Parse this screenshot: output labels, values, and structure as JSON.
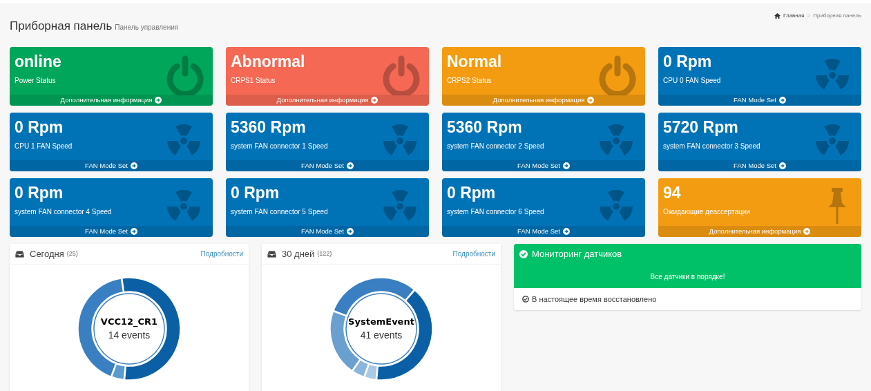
{
  "header": {
    "title": "Приборная панель",
    "subtitle": "Панель управления",
    "breadcrumb": [
      "Главная",
      "Приборная панель"
    ],
    "breadcrumb_separator": ">"
  },
  "tiles": [
    {
      "value": "online",
      "label": "Power Status",
      "link": "Дополнительная информация",
      "kind": "power",
      "color": "#00a65a"
    },
    {
      "value": "Abnormal",
      "label": "CRPS1 Status",
      "link": "Дополнительная информация",
      "kind": "power",
      "color": "#f56954"
    },
    {
      "value": "Normal",
      "label": "CRPS2 Status",
      "link": "Дополнительная информация",
      "kind": "power",
      "color": "#f39c12"
    },
    {
      "value": "0 Rpm",
      "label": "CPU 0 FAN Speed",
      "link": "FAN Mode Set",
      "kind": "fan",
      "color": "#0073b7"
    },
    {
      "value": "0 Rpm",
      "label": "CPU 1 FAN Speed",
      "link": "FAN Mode Set",
      "kind": "fan",
      "color": "#0073b7"
    },
    {
      "value": "5360 Rpm",
      "label": "system FAN connector 1 Speed",
      "link": "FAN Mode Set",
      "kind": "fan",
      "color": "#0073b7"
    },
    {
      "value": "5360 Rpm",
      "label": "system FAN connector 2 Speed",
      "link": "FAN Mode Set",
      "kind": "fan",
      "color": "#0073b7"
    },
    {
      "value": "5720 Rpm",
      "label": "system FAN connector 3 Speed",
      "link": "FAN Mode Set",
      "kind": "fan",
      "color": "#0073b7"
    },
    {
      "value": "0 Rpm",
      "label": "system FAN connector 4 Speed",
      "link": "FAN Mode Set",
      "kind": "fan",
      "color": "#0073b7"
    },
    {
      "value": "0 Rpm",
      "label": "system FAN connector 5 Speed",
      "link": "FAN Mode Set",
      "kind": "fan",
      "color": "#0073b7"
    },
    {
      "value": "0 Rpm",
      "label": "system FAN connector 6 Speed",
      "link": "FAN Mode Set",
      "kind": "fan",
      "color": "#0073b7"
    },
    {
      "value": "94",
      "label": "Ожидающие деассертации",
      "link": "Дополнительная информация",
      "kind": "pin",
      "color": "#f39c12"
    }
  ],
  "event_panels": [
    {
      "title": "Сегодня",
      "count": "(25)",
      "link": "Подробности",
      "center_title": "VCC12_CR1",
      "center_text": "14 events"
    },
    {
      "title": "30 дней",
      "count": "(122)",
      "link": "Подробности",
      "center_title": "SystemEvent",
      "center_text": "41 events"
    }
  ],
  "monitor": {
    "title": "Мониторинг датчиков",
    "message": "Все датчики в порядке!",
    "status": "В настоящее время восстановлено"
  }
}
